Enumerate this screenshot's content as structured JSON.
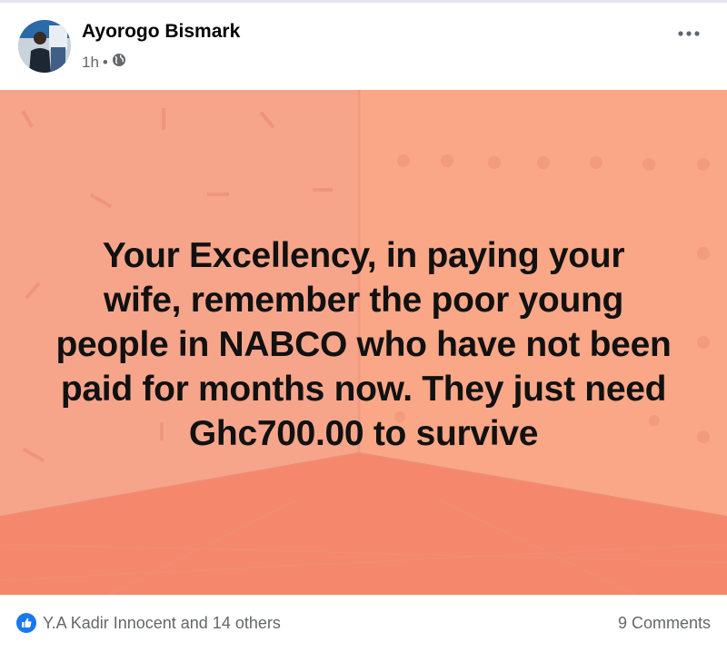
{
  "post": {
    "author": "Ayorogo Bismark",
    "time": "1h",
    "separator": "•",
    "audience_icon": "globe-icon",
    "more_icon": "more-options-icon",
    "text": "Your  Excellency, in paying your\nwife, remember the poor young\npeople in NABCO who have not been\npaid for months now. They just need\nGhc700.00 to survive",
    "background_colors": {
      "wall_left": "#f6a48a",
      "wall_right": "#f8a587",
      "floor": "#f27f68"
    }
  },
  "footer": {
    "reaction_icon": "like-reaction-icon",
    "reactors": "Y.A Kadir Innocent and 14 others",
    "comments": "9 Comments"
  },
  "colors": {
    "text_primary": "#050505",
    "text_secondary": "#65676b",
    "like_blue": "#1877f2"
  }
}
